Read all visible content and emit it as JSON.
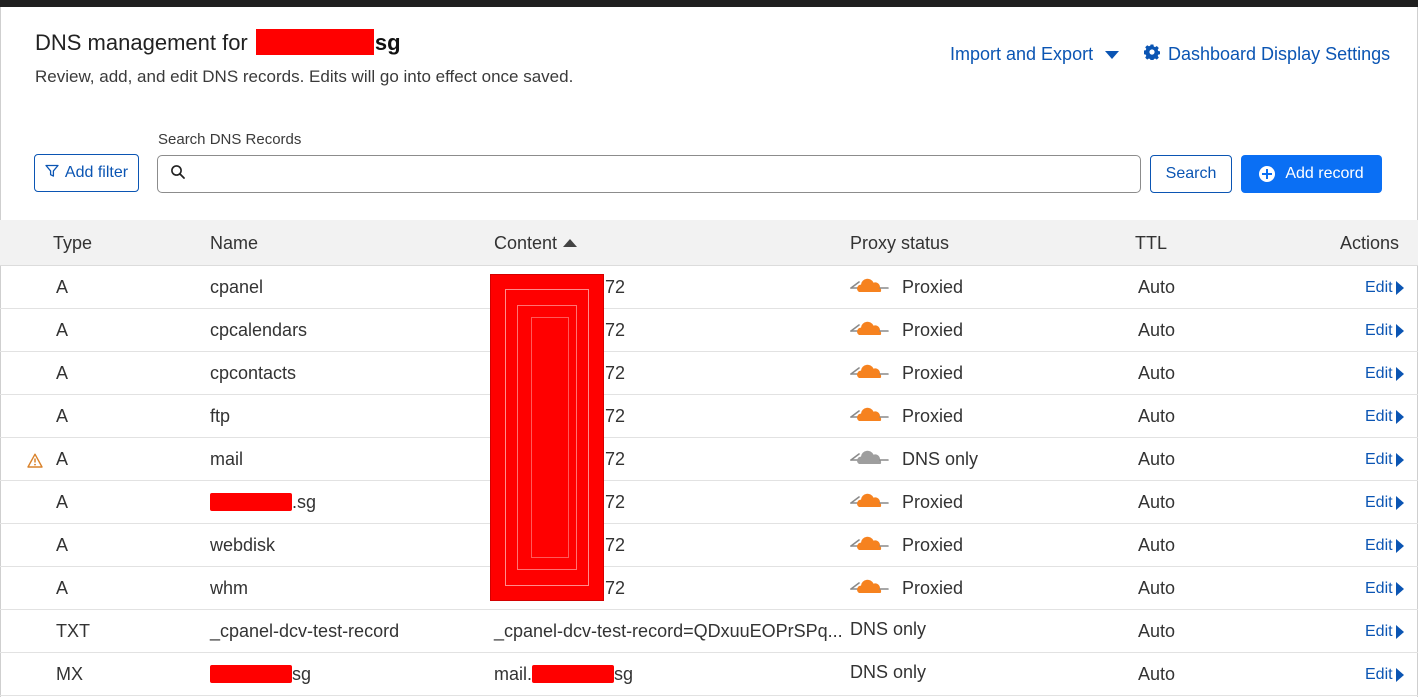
{
  "header": {
    "title_prefix": "DNS management for ",
    "title_suffix": "sg",
    "subtitle": "Review, add, and edit DNS records. Edits will go into effect once saved.",
    "import_export": "Import and Export",
    "dashboard_settings": "Dashboard Display Settings"
  },
  "toolbar": {
    "add_filter": "Add filter",
    "search_label": "Search DNS Records",
    "search_value": "",
    "search_button": "Search",
    "add_record": "Add record"
  },
  "table": {
    "columns": {
      "type": "Type",
      "name": "Name",
      "content": "Content",
      "proxy": "Proxy status",
      "ttl": "TTL",
      "actions": "Actions"
    },
    "content_sort": "ascending",
    "rows": [
      {
        "type": "A",
        "name": "cpanel",
        "name_suffix": "",
        "content": "72",
        "content_prefix": "",
        "proxy": "Proxied",
        "proxy_icon": "cloud-proxied",
        "ttl": "Auto",
        "action": "Edit",
        "warning": false
      },
      {
        "type": "A",
        "name": "cpcalendars",
        "name_suffix": "",
        "content": "72",
        "content_prefix": "",
        "proxy": "Proxied",
        "proxy_icon": "cloud-proxied",
        "ttl": "Auto",
        "action": "Edit",
        "warning": false
      },
      {
        "type": "A",
        "name": "cpcontacts",
        "name_suffix": "",
        "content": "72",
        "content_prefix": "",
        "proxy": "Proxied",
        "proxy_icon": "cloud-proxied",
        "ttl": "Auto",
        "action": "Edit",
        "warning": false
      },
      {
        "type": "A",
        "name": "ftp",
        "name_suffix": "",
        "content": "72",
        "content_prefix": "",
        "proxy": "Proxied",
        "proxy_icon": "cloud-proxied",
        "ttl": "Auto",
        "action": "Edit",
        "warning": false
      },
      {
        "type": "A",
        "name": "mail",
        "name_suffix": "",
        "content": "72",
        "content_prefix": "",
        "proxy": "DNS only",
        "proxy_icon": "cloud-dns-only",
        "ttl": "Auto",
        "action": "Edit",
        "warning": true
      },
      {
        "type": "A",
        "name": "",
        "name_suffix": ".sg",
        "content": "72",
        "content_prefix": "",
        "proxy": "Proxied",
        "proxy_icon": "cloud-proxied",
        "ttl": "Auto",
        "action": "Edit",
        "warning": false
      },
      {
        "type": "A",
        "name": "webdisk",
        "name_suffix": "",
        "content": "72",
        "content_prefix": "",
        "proxy": "Proxied",
        "proxy_icon": "cloud-proxied",
        "ttl": "Auto",
        "action": "Edit",
        "warning": false
      },
      {
        "type": "A",
        "name": "whm",
        "name_suffix": "",
        "content": "72",
        "content_prefix": "",
        "proxy": "Proxied",
        "proxy_icon": "cloud-proxied",
        "ttl": "Auto",
        "action": "Edit",
        "warning": false
      },
      {
        "type": "TXT",
        "name": "_cpanel-dcv-test-record",
        "name_suffix": "",
        "content": "_cpanel-dcv-test-record=QDxuuEOPrSPq...",
        "content_prefix": "",
        "proxy": "DNS only",
        "proxy_icon": "none",
        "ttl": "Auto",
        "action": "Edit",
        "warning": false
      },
      {
        "type": "MX",
        "name": "",
        "name_suffix": "sg",
        "content": "sg",
        "content_prefix": "mail.",
        "proxy": "DNS only",
        "proxy_icon": "none",
        "ttl": "Auto",
        "action": "Edit",
        "warning": false
      }
    ]
  },
  "colors": {
    "link": "#0b55b3",
    "primary_button": "#0a6ff4",
    "proxied_cloud": "#f6821f",
    "dns_only_cloud": "#9e9e9e",
    "warning": "#d9822b",
    "redaction": "#ff0000"
  }
}
